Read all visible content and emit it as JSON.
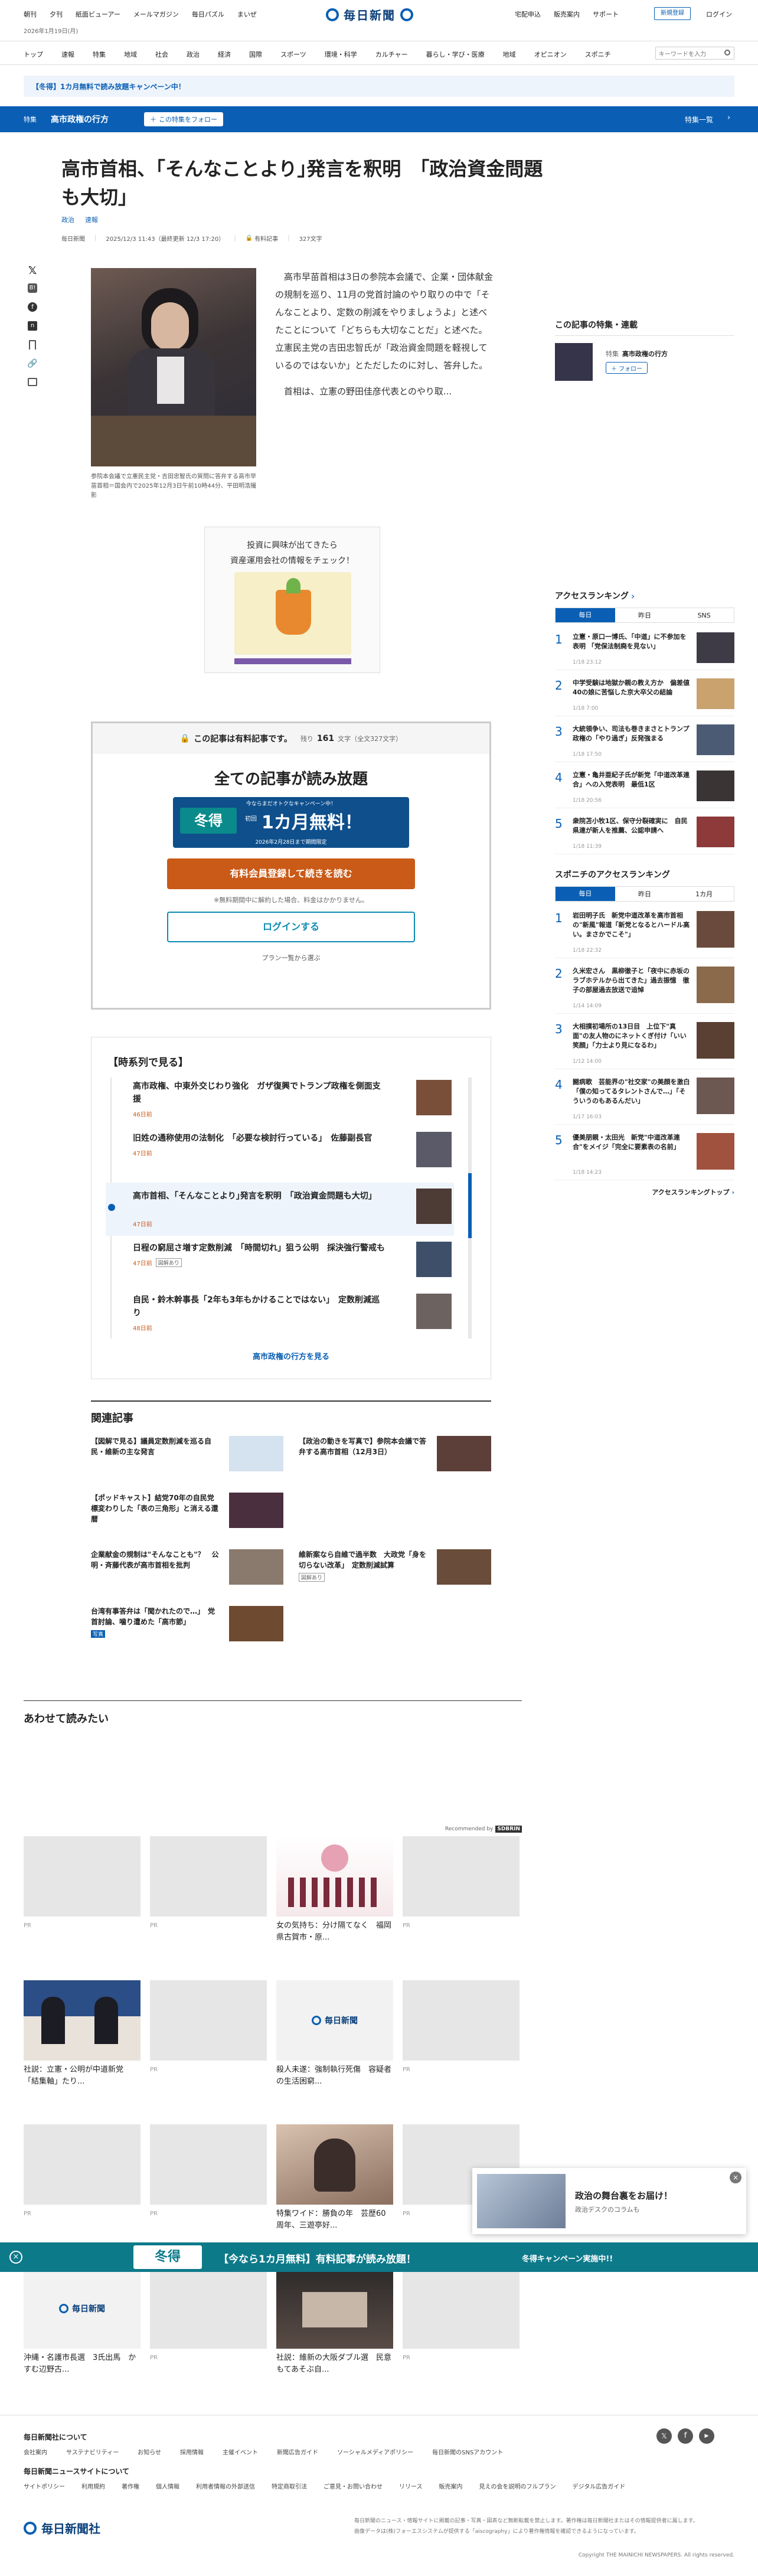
{
  "topnav": {
    "left": [
      "朝刊",
      "夕刊",
      "紙面ビューアー",
      "メールマガジン",
      "毎日パズル",
      "まいぜ"
    ],
    "date": "2026年1月19日(月)",
    "logo": "毎日新聞",
    "right": [
      "宅配申込",
      "販売案内",
      "サポート"
    ],
    "register": "新規登録",
    "login": "ログイン"
  },
  "catnav": {
    "items": [
      "トップ",
      "速報",
      "特集",
      "地域",
      "社会",
      "政治",
      "経済",
      "国際",
      "スポーツ",
      "環境・科学",
      "カルチャー",
      "暮らし・学び・医療",
      "地域",
      "オピニオン",
      "スポニチ"
    ],
    "search_placeholder": "キーワードを入力"
  },
  "campaign_banner": "【冬得】1カ月無料で読み放題キャンペーン中！",
  "special_bar": {
    "tag": "特集",
    "title": "高市政権の行方",
    "follow": "この特集をフォロー",
    "list": "特集一覧"
  },
  "article": {
    "headline": "高市首相、｢そんなことより｣発言を釈明　「政治資金問題も大切」",
    "tags": [
      "政治",
      "速報"
    ],
    "source": "毎日新聞",
    "date": "2025/12/3 11:43（最終更新 12/3 17:20）",
    "type": "有料記事",
    "chars": "327文字",
    "caption": "参院本会議で立憲民主党・吉田忠智氏の質問に答弁する高市早苗首相＝国会内で2025年12月3日午前10時44分、平田明浩撮影",
    "body1": "高市早苗首相は3日の参院本会議で、企業・団体献金の規制を巡り、11月の党首討論のやり取りの中で「そんなことより、定数の削減をやりましょうよ」と述べたことについて「どちらも大切なことだ」と述べた。立憲民主党の吉田忠智氏が「政治資金問題を軽視しているのではないか」とただしたのに対し、答弁した。",
    "body2": "首相は、立憲の野田佳彦代表とのやり取..."
  },
  "share_icons": [
    "x-icon",
    "hatena-icon",
    "facebook-icon",
    "bookmark-icon",
    "note-icon",
    "link-icon",
    "print-icon"
  ],
  "ad_top": {
    "line1": "投資に興味が出てきたら",
    "line2": "資産運用会社の情報をチェック！"
  },
  "paywall": {
    "lock_text": "この記事は有料記事です。",
    "remain": "残り",
    "remain_num": "161",
    "remain_unit": "文字（全文327文字）",
    "headline": "全ての記事が読み放題",
    "sub": "今ならまだオトクなキャンペーン中！",
    "fuyutoku": "冬得",
    "price_small": "初回",
    "price": "1カ月無料！",
    "period": "2026年2月28日まで期間限定",
    "cta": "有料会員登録して続きを読む",
    "note": "※無料期間中に解約した場合、料金はかかりません。",
    "login": "ログインする",
    "plans": "プラン一覧から選ぶ"
  },
  "timeline": {
    "title": "【時系列で見る】",
    "items": [
      {
        "title": "高市政権、中東外交じわり強化　ガザ復興でトランプ政権を側面支援",
        "date": "46日前"
      },
      {
        "title": "旧姓の通称使用の法制化　「必要な検討行っている」　佐藤副長官",
        "date": "47日前"
      },
      {
        "title": "高市首相、｢そんなことより｣発言を釈明　「政治資金問題も大切」",
        "date": "47日前"
      },
      {
        "title": "日程の窮屈さ増す定数削減　「時間切れ」狙う公明　採決強行警戒も",
        "date": "47日前",
        "badge": "図解あり"
      },
      {
        "title": "自民・鈴木幹事長「2年も3年もかけることではない」　定数削減巡り",
        "date": "48日前"
      }
    ],
    "more": "高市政権の行方を見る"
  },
  "related": {
    "title": "関連記事",
    "items": [
      "【図解で見る】議員定数削減を巡る自民・維新の主な発言",
      "【政治の動きを写真で】参院本会議で答弁する高市首相（12月3日）",
      "【ポッドキャスト】結党70年の自民党　標変わりした「表の三角形」と消える還暦",
      "企業献金の規制は\"そんなことも\"？　公明・斉藤代表が高市首相を批判",
      "維新案なら自維で過半数　大政党「身を切らない改革」　定数削減試算",
      "台湾有事答弁は「聞かれたので…」　党首討論、噛り遭めた「高市節」"
    ],
    "badges": [
      "図解あり",
      "写真"
    ]
  },
  "recommend": {
    "title": "あわせて読みたい",
    "recommended_by": "Recommended by",
    "outbrain": "SDBRIN",
    "cards": [
      {
        "title": "",
        "pr": "PR"
      },
      {
        "title": "",
        "pr": "PR"
      },
      {
        "title": "女の気持ち：分け隔てなく　福岡県古賀市・原...",
        "pr": ""
      },
      {
        "title": "",
        "pr": "PR"
      },
      {
        "title": "社説：立憲・公明が中道新党　「結集軸」たり...",
        "pr": ""
      },
      {
        "title": "",
        "pr": "PR"
      },
      {
        "title": "殺人未遂：強制執行死傷　容疑者の生活困窮...",
        "pr": ""
      },
      {
        "title": "",
        "pr": "PR"
      },
      {
        "title": "",
        "pr": "PR"
      },
      {
        "title": "",
        "pr": "PR"
      },
      {
        "title": "特集ワイド：勝負の年　芸歴60周年、三遊亭好...",
        "pr": ""
      },
      {
        "title": "",
        "pr": "PR"
      },
      {
        "title": "沖縄・名護市長選　3氏出馬　かすむ辺野古...",
        "pr": ""
      },
      {
        "title": "",
        "pr": "PR"
      },
      {
        "title": "社説：維新の大阪ダブル選　民意もてあそぶ自...",
        "pr": ""
      },
      {
        "title": "",
        "pr": "PR"
      }
    ]
  },
  "sidebar": {
    "special_title": "この記事の特集・連載",
    "special_tag": "特集",
    "special_name": "高市政権の行方",
    "follow": "フォロー",
    "ranking_title": "アクセスランキング",
    "tabs": [
      "毎日",
      "昨日",
      "SNS"
    ],
    "ranking": [
      {
        "t": "立憲・原口一博氏、「中道」に不参加を表明 「党保法制廃を見ない」",
        "d": "1/18 23:12"
      },
      {
        "t": "中学受験は地獄か親の教え方か　偏差値40の娘に苦悩した京大卒父の結論",
        "d": "1/18 7:00"
      },
      {
        "t": "大統領争い、司法も巻きまさとトランプ政権の「やり過ぎ」反発強まる",
        "d": "1/18 17:50"
      },
      {
        "t": "立憲・亀井亜紀子氏が新党「中道改革連合」への入党表明　最低1区",
        "d": "1/18 20:56"
      },
      {
        "t": "衆院苫小牧1区、保守分裂確実に　自民県連が新人を推薦、公認申請へ",
        "d": "1/18 11:39"
      }
    ],
    "sponichi_title": "スポニチのアクセスランキング",
    "sp_tabs": [
      "毎日",
      "昨日",
      "1カ月"
    ],
    "sp_ranking": [
      {
        "t": "岩田明子氏　新党中道改革を高市首相の\"新風\"報道「新党となるとハードル高い。まさかでこそ\"」",
        "d": "1/18 22:32"
      },
      {
        "t": "久米宏さん　黒柳徹子と「夜中に赤坂のラブホテルから出てきた」過去振憶　徹子の部屋過去放送で追悼",
        "d": "1/14 14:09"
      },
      {
        "t": "大相撲初場所の13日目　上位下\"真面\"の友人物のにネットくぎ付け「いい笑顔」「力士より見になるわ」",
        "d": "1/12 14:00"
      },
      {
        "t": "闘病歌　芸能界の\"社交家\"の美顔を激白「僕の知ってるタレントさんで…」「そういうのもあるんだい」",
        "d": "1/17 16:03"
      },
      {
        "t": "優美朋親・太田光　新党\"中道改革連合\"をメイジ「完全に要素表の名前」",
        "d": "1/18 14:23"
      }
    ],
    "more": "アクセスランキングトップ"
  },
  "ad_float": {
    "title": "政治の舞台裏をお届け！",
    "sub": "政治デスクのコラムも"
  },
  "bottom_banner": {
    "fuyutoku": "冬得",
    "text": "【今なら1カ月無料】有料記事が読み放題！",
    "cta": "冬得キャンペーン実施中!!"
  },
  "footer": {
    "about": "毎日新聞社について",
    "links1": [
      "会社案内",
      "サステナビリティー",
      "お知らせ",
      "採用情報",
      "主催イベント",
      "新聞広告ガイド",
      "ソーシャルメディアポリシー",
      "毎日新聞のSNSアカウント"
    ],
    "news_site": "毎日新聞ニュースサイトについて",
    "links2": [
      "サイトポリシー",
      "利用規約",
      "著作権",
      "個人情報",
      "利用者情報の外部送信",
      "特定商取引法",
      "ご意見・お問い合わせ",
      "リリース",
      "販売案内",
      "見えの会を説明のフルプラン",
      "デジタル広告ガイド"
    ],
    "logo": "毎日新聞社",
    "notice": "毎日新聞のニュース・情報サイトに掲載の記事・写真・図表など無断転載を禁止します。著作権は毎日新聞社またはその情報提供者に属します。",
    "notice2": "画像データは(株)フォーエスシステムが提供する「aiscography」により著作権情報を確認できるようになっています。",
    "copyright": "Copyright THE MAINICHI NEWSPAPERS. All rights reserved."
  }
}
